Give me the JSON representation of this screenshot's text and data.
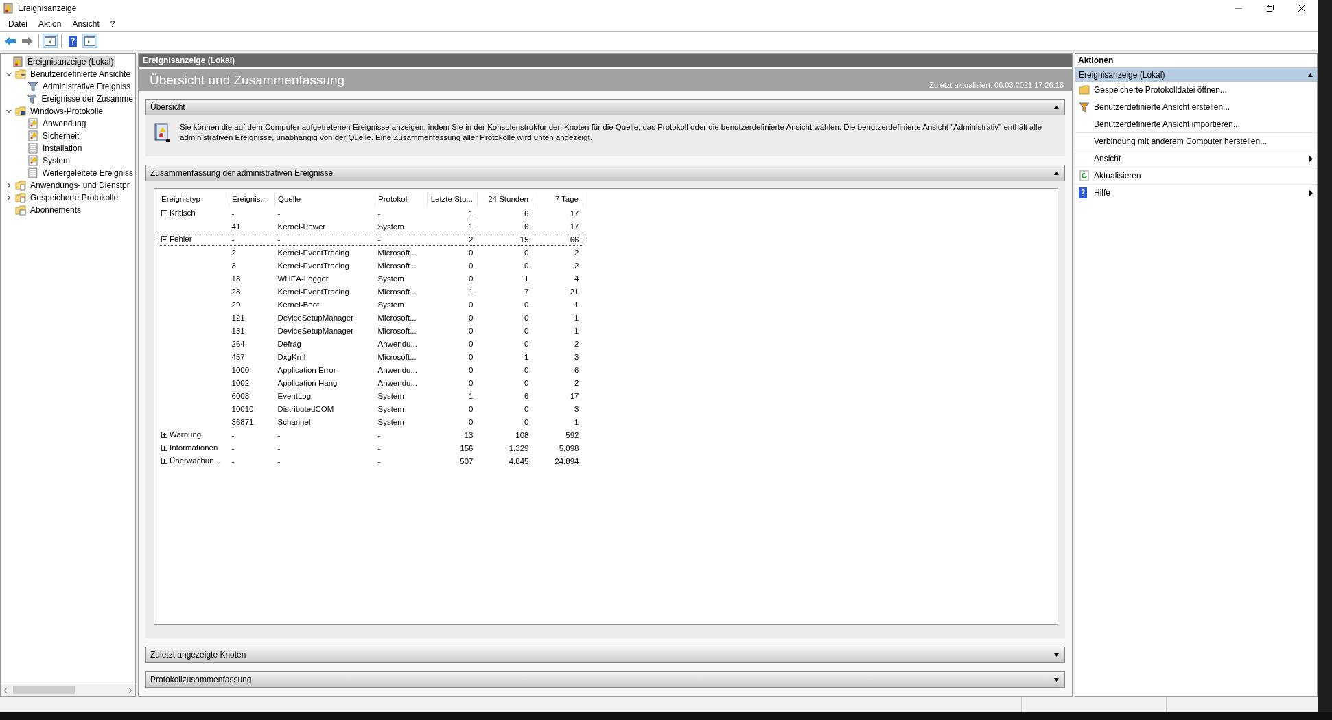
{
  "window": {
    "title": "Ereignisanzeige"
  },
  "menu": [
    "Datei",
    "Aktion",
    "Ansicht",
    "?"
  ],
  "toolbar": [
    {
      "kind": "back",
      "on": false
    },
    {
      "kind": "forward",
      "on": false
    },
    {
      "kind": "tree-pane",
      "on": true
    },
    {
      "kind": "help",
      "on": false
    },
    {
      "kind": "action-pane",
      "on": true
    }
  ],
  "tree": [
    {
      "label": "Ereignisanzeige (Lokal)",
      "selected": true,
      "kind": "root",
      "children": [
        {
          "label": "Benutzerdefinierte Ansichte",
          "selected": false,
          "kind": "folder-filter",
          "expanded": true,
          "children": [
            {
              "label": "Administrative Ereigniss",
              "selected": false,
              "kind": "filter"
            },
            {
              "label": "Ereignisse der Zusamme",
              "selected": false,
              "kind": "filter"
            }
          ]
        },
        {
          "label": "Windows-Protokolle",
          "selected": false,
          "kind": "folder-pc",
          "expanded": true,
          "children": [
            {
              "label": "Anwendung",
              "selected": false,
              "kind": "log-warn"
            },
            {
              "label": "Sicherheit",
              "selected": false,
              "kind": "log-warn"
            },
            {
              "label": "Installation",
              "selected": false,
              "kind": "log"
            },
            {
              "label": "System",
              "selected": false,
              "kind": "log-warn"
            },
            {
              "label": "Weitergeleitete Ereigniss",
              "selected": false,
              "kind": "log"
            }
          ]
        },
        {
          "label": "Anwendungs- und Dienstpr",
          "selected": false,
          "kind": "folder-log",
          "expanded": false
        },
        {
          "label": "Gespeicherte Protokolle",
          "selected": false,
          "kind": "folder-log",
          "expanded": false
        },
        {
          "label": "Abonnements",
          "selected": false,
          "kind": "folder-sub"
        }
      ]
    }
  ],
  "center": {
    "header": "Ereignisanzeige (Lokal)",
    "title": "Übersicht und Zusammenfassung",
    "last_updated": "Zuletzt aktualisiert: 06.03.2021 17:26:18",
    "sections": [
      {
        "title": "Übersicht",
        "expanded": true,
        "kind": "text",
        "text": "Sie können die auf dem Computer aufgetretenen Ereignisse anzeigen, indem Sie in der Konsolenstruktur den Knoten für die Quelle, das Protokoll oder die benutzerdefinierte Ansicht wählen. Die benutzerdefinierte Ansicht \"Administrativ\" enthält alle administrativen Ereignisse, unabhängig von der Quelle. Eine Zusammenfassung aller Protokolle wird unten angezeigt."
      },
      {
        "title": "Zusammenfassung der administrativen Ereignisse",
        "expanded": true,
        "kind": "table",
        "table": {
          "columns": [
            "Ereignistyp",
            "Ereignis...",
            "Quelle",
            "Protokoll",
            "Letzte Stu...",
            "24 Stunden",
            "7 Tage"
          ],
          "groups": [
            {
              "cells": [
                "Kritisch",
                "-",
                "-",
                "-",
                "1",
                "6",
                "17"
              ],
              "expanded": true,
              "selected": false,
              "rows": [
                [
                  "41",
                  "Kernel-Power",
                  "System",
                  "1",
                  "6",
                  "17"
                ]
              ]
            },
            {
              "cells": [
                "Fehler",
                "-",
                "-",
                "-",
                "2",
                "15",
                "66"
              ],
              "expanded": true,
              "selected": true,
              "rows": [
                [
                  "2",
                  "Kernel-EventTracing",
                  "Microsoft...",
                  "0",
                  "0",
                  "2"
                ],
                [
                  "3",
                  "Kernel-EventTracing",
                  "Microsoft...",
                  "0",
                  "0",
                  "2"
                ],
                [
                  "18",
                  "WHEA-Logger",
                  "System",
                  "0",
                  "1",
                  "4"
                ],
                [
                  "28",
                  "Kernel-EventTracing",
                  "Microsoft...",
                  "1",
                  "7",
                  "21"
                ],
                [
                  "29",
                  "Kernel-Boot",
                  "System",
                  "0",
                  "0",
                  "1"
                ],
                [
                  "121",
                  "DeviceSetupManager",
                  "Microsoft...",
                  "0",
                  "0",
                  "1"
                ],
                [
                  "131",
                  "DeviceSetupManager",
                  "Microsoft...",
                  "0",
                  "0",
                  "1"
                ],
                [
                  "264",
                  "Defrag",
                  "Anwendu...",
                  "0",
                  "0",
                  "2"
                ],
                [
                  "457",
                  "DxgKrnl",
                  "Microsoft...",
                  "0",
                  "1",
                  "3"
                ],
                [
                  "1000",
                  "Application Error",
                  "Anwendu...",
                  "0",
                  "0",
                  "6"
                ],
                [
                  "1002",
                  "Application Hang",
                  "Anwendu...",
                  "0",
                  "0",
                  "2"
                ],
                [
                  "6008",
                  "EventLog",
                  "System",
                  "1",
                  "6",
                  "17"
                ],
                [
                  "10010",
                  "DistributedCOM",
                  "System",
                  "0",
                  "0",
                  "3"
                ],
                [
                  "36871",
                  "Schannel",
                  "System",
                  "0",
                  "0",
                  "1"
                ]
              ]
            },
            {
              "cells": [
                "Warnung",
                "-",
                "-",
                "-",
                "13",
                "108",
                "592"
              ],
              "expanded": false,
              "selected": false
            },
            {
              "cells": [
                "Informationen",
                "-",
                "-",
                "-",
                "156",
                "1.329",
                "5.098"
              ],
              "expanded": false,
              "selected": false
            },
            {
              "cells": [
                "Überwachun...",
                "-",
                "-",
                "-",
                "507",
                "4.845",
                "24.894"
              ],
              "expanded": false,
              "selected": false
            }
          ]
        }
      },
      {
        "title": "Zuletzt angezeigte Knoten",
        "expanded": false,
        "kind": "empty"
      },
      {
        "title": "Protokollzusammenfassung",
        "expanded": false,
        "kind": "empty"
      }
    ]
  },
  "actions": {
    "title": "Aktionen",
    "section": {
      "title": "Ereignisanzeige (Lokal)",
      "expanded": true
    },
    "items": [
      {
        "label": "Gespeicherte Protokolldatei öffnen...",
        "kind": "folder",
        "submenu": false
      },
      {
        "label": "Benutzerdefinierte Ansicht erstellen...",
        "kind": "filter",
        "submenu": false
      },
      {
        "label": "Benutzerdefinierte Ansicht importieren...",
        "kind": "plain",
        "submenu": false
      },
      {
        "label": "Verbindung mit anderem Computer herstellen...",
        "kind": "plain",
        "submenu": false
      },
      {
        "label": "Ansicht",
        "kind": "plain",
        "submenu": true
      },
      {
        "label": "Aktualisieren",
        "kind": "refresh",
        "submenu": false
      },
      {
        "label": "Hilfe",
        "kind": "help",
        "submenu": true
      }
    ]
  }
}
